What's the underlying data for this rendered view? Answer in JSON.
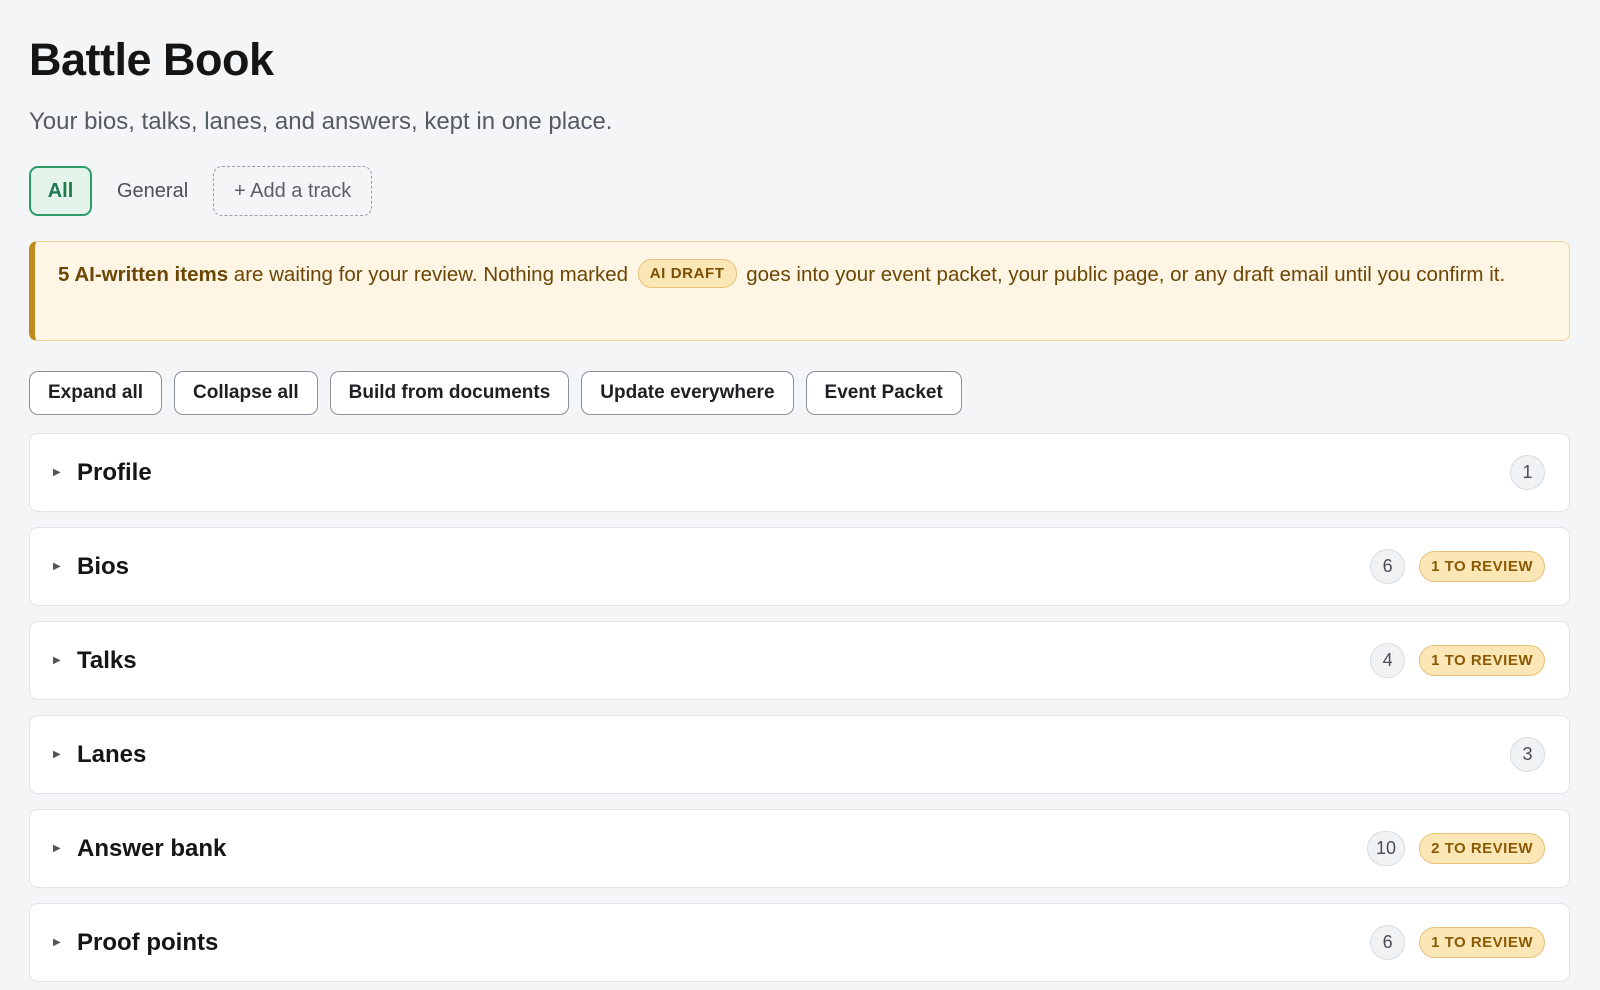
{
  "header": {
    "title": "Battle Book",
    "subtitle": "Your bios, talks, lanes, and answers, kept in one place."
  },
  "tracks": {
    "all": "All",
    "general": "General",
    "add": "+ Add a track"
  },
  "notice": {
    "bold": "5 AI-written items",
    "text1": " are waiting for your review. Nothing marked ",
    "badge": "AI DRAFT",
    "text2": " goes into your event packet, your public page, or any draft email until you confirm it."
  },
  "actions": [
    "Expand all",
    "Collapse all",
    "Build from documents",
    "Update everywhere",
    "Event Packet"
  ],
  "sections": [
    {
      "title": "Profile",
      "count": "1",
      "review": ""
    },
    {
      "title": "Bios",
      "count": "6",
      "review": "1 TO REVIEW"
    },
    {
      "title": "Talks",
      "count": "4",
      "review": "1 TO REVIEW"
    },
    {
      "title": "Lanes",
      "count": "3",
      "review": ""
    },
    {
      "title": "Answer bank",
      "count": "10",
      "review": "2 TO REVIEW"
    },
    {
      "title": "Proof points",
      "count": "6",
      "review": "1 TO REVIEW"
    }
  ],
  "icons": {
    "caret": "caret-right-icon"
  },
  "colors": {
    "accent_green": "#2e9a68",
    "warning_bg": "#fef5e5",
    "warning_border": "#c08b1c",
    "review_badge": "#fbe6b6"
  }
}
